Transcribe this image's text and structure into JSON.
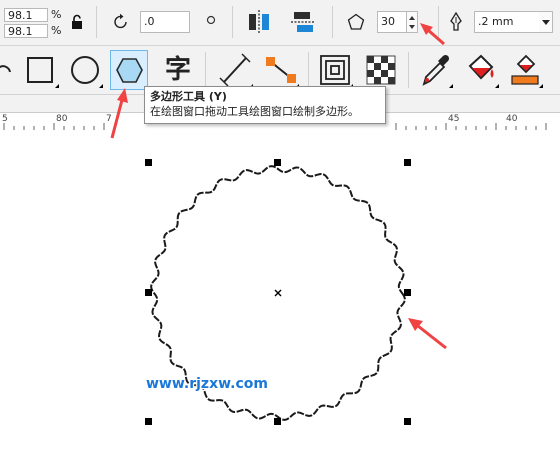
{
  "property_bar": {
    "scale_x_value": "98.1",
    "scale_y_value": "98.1",
    "percent_symbol": "%",
    "rotation_value": ".0",
    "sides_value": "30",
    "outline_width_value": ".2 mm"
  },
  "ruler": {
    "ticks": [
      "5",
      "80",
      "7",
      "45",
      "40"
    ]
  },
  "tooltip": {
    "title": "多边形工具 (Y)",
    "description": "在绘图窗口拖动工具绘图窗口绘制多边形。"
  },
  "tools": [
    "spiral-tool",
    "rectangle-tool",
    "ellipse-tool",
    "polygon-tool",
    "text-tool",
    "dimension-tool",
    "connector-tool",
    "contour-tool",
    "transparency-tool",
    "eyedropper-tool",
    "fill-tool",
    "smart-fill-tool"
  ],
  "text_tool_glyph": "字",
  "selected_tool": "polygon-tool",
  "watermark": "www.rjzxw.com",
  "colors": {
    "annotation_arrow": "#f04242",
    "watermark": "#1b78d8",
    "selection_highlight": "#d9efff"
  }
}
